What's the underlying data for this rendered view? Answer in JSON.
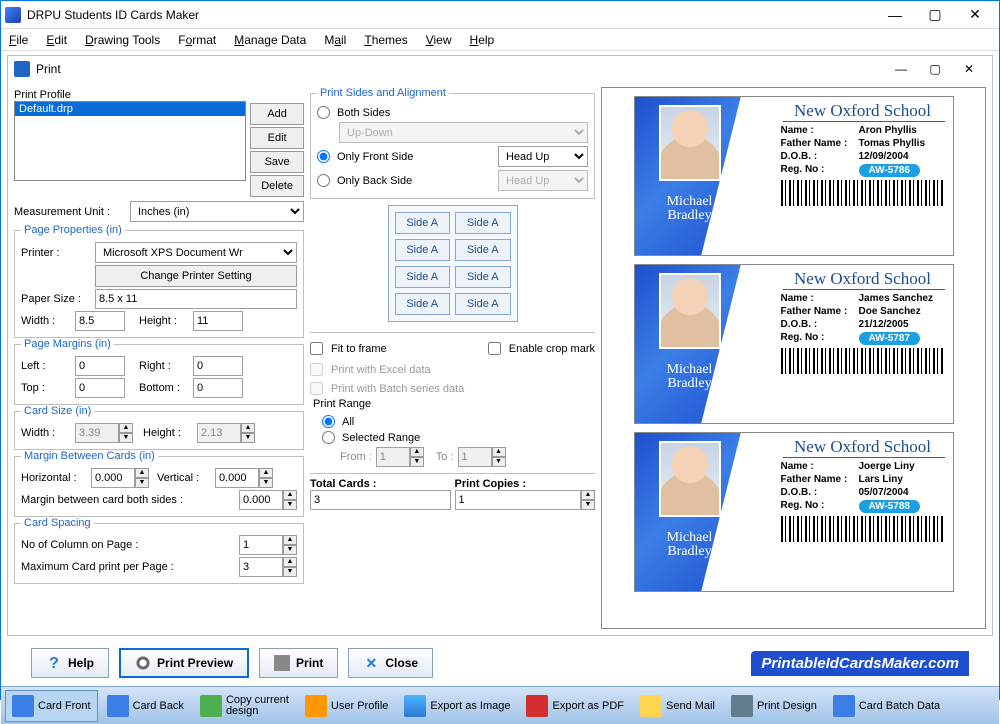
{
  "app": {
    "title": "DRPU Students ID Cards Maker"
  },
  "menu": [
    "File",
    "Edit",
    "Drawing Tools",
    "Format",
    "Manage Data",
    "Mail",
    "Themes",
    "View",
    "Help"
  ],
  "print_window": {
    "title": "Print"
  },
  "profile": {
    "label": "Print Profile",
    "items": [
      "Default.drp"
    ],
    "buttons": {
      "add": "Add",
      "edit": "Edit",
      "save": "Save",
      "delete": "Delete"
    }
  },
  "measurement": {
    "label": "Measurement Unit :",
    "value": "Inches (in)"
  },
  "page_props": {
    "title": "Page Properties (in)",
    "printer_label": "Printer :",
    "printer_value": "Microsoft XPS Document Wr",
    "change_printer": "Change Printer Setting",
    "paper_size_label": "Paper Size :",
    "paper_size": "8.5 x 11",
    "width_label": "Width :",
    "width": "8.5",
    "height_label": "Height :",
    "height": "11"
  },
  "margins": {
    "title": "Page Margins (in)",
    "left_label": "Left :",
    "left": "0",
    "right_label": "Right :",
    "right": "0",
    "top_label": "Top :",
    "top": "0",
    "bottom_label": "Bottom :",
    "bottom": "0"
  },
  "card_size": {
    "title": "Card Size (in)",
    "width_label": "Width :",
    "width": "3.39",
    "height_label": "Height :",
    "height": "2.13"
  },
  "between": {
    "title": "Margin Between Cards (in)",
    "hor_label": "Horizontal :",
    "hor": "0.000",
    "ver_label": "Vertical :",
    "ver": "0.000",
    "both_label": "Margin between card both sides :",
    "both": "0.000"
  },
  "spacing": {
    "title": "Card Spacing",
    "cols_label": "No of Column on Page :",
    "cols": "1",
    "max_label": "Maximum Card print per Page :",
    "max": "3"
  },
  "sides": {
    "title": "Print Sides and Alignment",
    "both": "Both Sides",
    "updown": "Up-Down",
    "front": "Only Front Side",
    "back": "Only Back Side",
    "headup": "Head Up",
    "side_a": "Side A"
  },
  "options": {
    "fit": "Fit to frame",
    "crop": "Enable crop mark",
    "excel": "Print with Excel data",
    "batch": "Print with Batch series data"
  },
  "range": {
    "title": "Print Range",
    "all": "All",
    "selected": "Selected Range",
    "from_label": "From :",
    "from": "1",
    "to_label": "To :",
    "to": "1"
  },
  "totals": {
    "cards_label": "Total Cards :",
    "cards": "3",
    "copies_label": "Print Copies :",
    "copies": "1"
  },
  "buttons": {
    "help": "Help",
    "preview": "Print Preview",
    "print": "Print",
    "close": "Close"
  },
  "cards": [
    {
      "school": "New Oxford School",
      "name": "Aron Phyllis",
      "father": "Tomas Phyllis",
      "dob": "12/09/2004",
      "reg": "AW-5786",
      "sign": "Michael\nBradley"
    },
    {
      "school": "New Oxford School",
      "name": "James Sanchez",
      "father": "Doe Sanchez",
      "dob": "21/12/2005",
      "reg": "AW-5787",
      "sign": "Michael\nBradley"
    },
    {
      "school": "New Oxford School",
      "name": "Joerge Liny",
      "father": "Lars Liny",
      "dob": "05/07/2004",
      "reg": "AW-5788",
      "sign": "Michael\nBradley"
    }
  ],
  "card_labels": {
    "name": "Name :",
    "father": "Father Name :",
    "dob": "D.O.B. :",
    "reg": "Reg. No :"
  },
  "watermark": "PrintableIdCardsMaker.com",
  "toolbar": {
    "card_front": "Card Front",
    "card_back": "Card Back",
    "copy": "Copy current\ndesign",
    "user": "User Profile",
    "export_img": "Export as Image",
    "export_pdf": "Export as PDF",
    "send_mail": "Send Mail",
    "print_design": "Print Design",
    "batch": "Card Batch Data"
  }
}
